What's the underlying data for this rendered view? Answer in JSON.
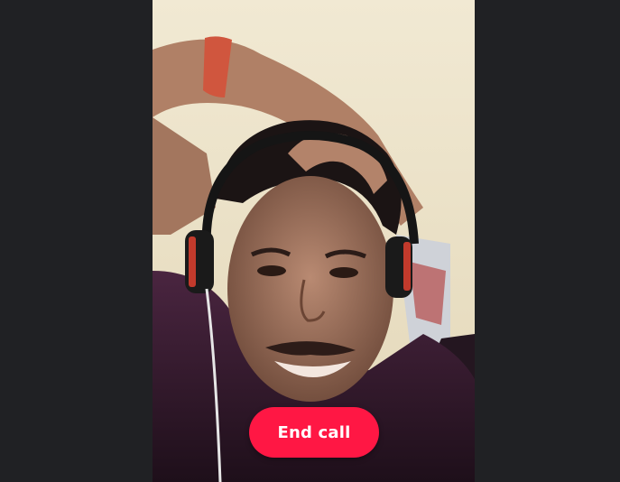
{
  "call": {
    "end_call_label": "End call"
  },
  "colors": {
    "background": "#202124",
    "end_call": "#ff1744",
    "end_call_text": "#ffffff"
  }
}
